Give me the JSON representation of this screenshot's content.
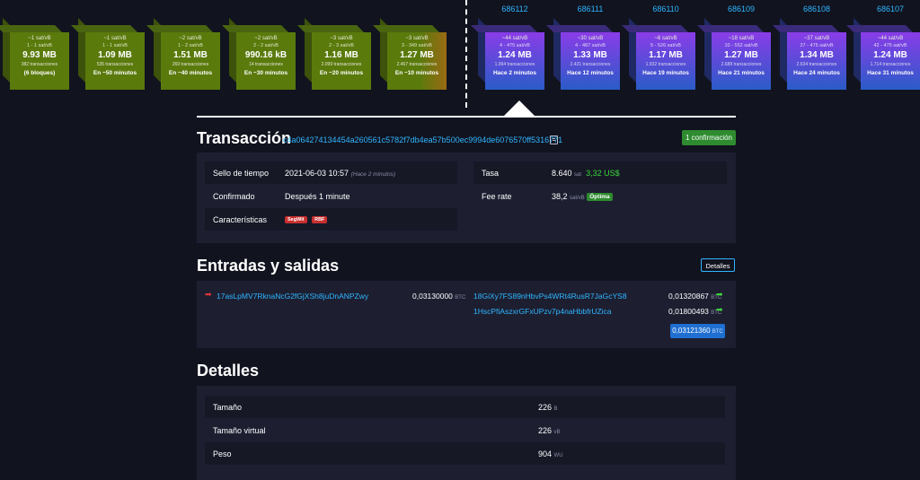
{
  "projected_blocks": [
    {
      "fee": "~1 sat/vB",
      "range": "1 - 1 sat/vB",
      "size": "9.93 MB",
      "txs": "382 transacciones",
      "time": "(6 bloques)"
    },
    {
      "fee": "~1 sat/vB",
      "range": "1 - 1 sat/vB",
      "size": "1.09 MB",
      "txs": "535 transacciones",
      "time": "En ~50 minutos"
    },
    {
      "fee": "~2 sat/vB",
      "range": "1 - 2 sat/vB",
      "size": "1.51 MB",
      "txs": "269 transacciones",
      "time": "En ~40 minutos"
    },
    {
      "fee": "~2 sat/vB",
      "range": "2 - 2 sat/vB",
      "size": "990.16 kB",
      "txs": "14 transacciones",
      "time": "En ~30 minutos"
    },
    {
      "fee": "~3 sat/vB",
      "range": "2 - 3 sat/vB",
      "size": "1.16 MB",
      "txs": "2.099 transacciones",
      "time": "En ~20 minutos"
    },
    {
      "fee": "~3 sat/vB",
      "range": "3 - 349 sat/vB",
      "size": "1.27 MB",
      "txs": "2.467 transacciones",
      "time": "En ~10 minutos"
    }
  ],
  "mined_blocks": [
    {
      "height": "686112",
      "fee": "~44 sat/vB",
      "range": "4 - 475 sat/vB",
      "size": "1.24 MB",
      "txs": "1.994 transacciones",
      "time": "Hace 2 minutos"
    },
    {
      "height": "686111",
      "fee": "~30 sat/vB",
      "range": "4 - 487 sat/vB",
      "size": "1.33 MB",
      "txs": "2.431 transacciones",
      "time": "Hace 12 minutos"
    },
    {
      "height": "686110",
      "fee": "~6 sat/vB",
      "range": "5 - 526 sat/vB",
      "size": "1.17 MB",
      "txs": "1.932 transacciones",
      "time": "Hace 19 minutos"
    },
    {
      "height": "686109",
      "fee": "~18 sat/vB",
      "range": "10 - 552 sat/vB",
      "size": "1.27 MB",
      "txs": "2.688 transacciones",
      "time": "Hace 21 minutos"
    },
    {
      "height": "686108",
      "fee": "~37 sat/vB",
      "range": "27 - 475 sat/vB",
      "size": "1.34 MB",
      "txs": "2.634 transacciones",
      "time": "Hace 24 minutos"
    },
    {
      "height": "686107",
      "fee": "~44 sat/vB",
      "range": "42 - 475 sat/vB",
      "size": "1.24 MB",
      "txs": "1.714 transacciones",
      "time": "Hace 31 minutos"
    }
  ],
  "transaction": {
    "title": "Transacción",
    "txid": "c4a064274134454a260561c5782f7db4ea57b500ec9994de6076570ff5316771",
    "confirmations": "1 confirmación",
    "timestamp_label": "Sello de tiempo",
    "timestamp_value": "2021-06-03 10:57",
    "timestamp_ago": "(Hace 2 minutos)",
    "confirmed_label": "Confirmado",
    "confirmed_value": "Después 1 minute",
    "features_label": "Características",
    "feature_tags": [
      "SegWit",
      "RBF"
    ],
    "fee_label": "Tasa",
    "fee_value": "8.640",
    "fee_unit": "sat",
    "fee_usd": "3,32 US$",
    "feerate_label": "Fee rate",
    "feerate_value": "38,2",
    "feerate_unit": "sat/vB",
    "feerate_badge": "Óptima"
  },
  "io": {
    "title": "Entradas y salidas",
    "details_button": "Detalles",
    "inputs": [
      {
        "address": "17asLpMV7RknaNcG2fGjXSh8juDnANPZwy",
        "amount": "0,03130000",
        "unit": "BTC"
      }
    ],
    "outputs": [
      {
        "address": "18GiXy7FS89nHbvPs4WRt4RusR7JaGcYS8",
        "amount": "0,01320867",
        "unit": "BTC"
      },
      {
        "address": "1HscPfiAszxrGFxUPzv7p4naHbbfrUZica",
        "amount": "0,01800493",
        "unit": "BTC"
      }
    ],
    "total": "0,03121360",
    "total_unit": "BTC"
  },
  "details": {
    "title": "Detalles",
    "rows": [
      {
        "label": "Tamaño",
        "value": "226",
        "unit": "B"
      },
      {
        "label": "Tamaño virtual",
        "value": "226",
        "unit": "vB"
      },
      {
        "label": "Peso",
        "value": "904",
        "unit": "WU"
      }
    ]
  },
  "colors": {
    "accent": "#2fb6ff",
    "projected": "#5a7a0c",
    "mined_top": "#8a3ce8",
    "mined_bottom": "#2a5cc8",
    "confirm": "#2e8b2f"
  }
}
